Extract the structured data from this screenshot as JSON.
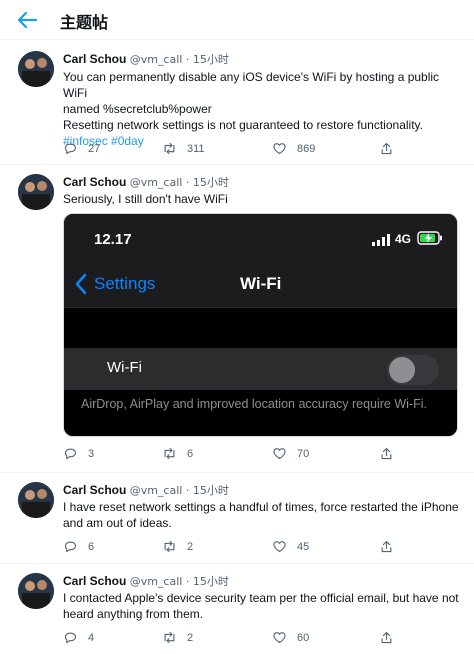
{
  "header": {
    "title": "主题帖",
    "back_icon": "arrow-left-icon",
    "accent": "#1d9bf0"
  },
  "tweets": [
    {
      "author": "Carl Schou",
      "meta": "@vm_call · 15小时",
      "text_lines": [
        "You can permanently disable any iOS device's WiFi by hosting a public WiFi",
        "named %secretclub%power",
        "Resetting network settings is not guaranteed to restore functionality."
      ],
      "hashtags": "#infosec #0day",
      "replies": "27",
      "retweets": "311",
      "likes": "869"
    },
    {
      "author": "Carl Schou",
      "meta": "@vm_call · 15小时",
      "text_lines": [
        "Seriously, I still don't have WiFi"
      ],
      "replies": "3",
      "retweets": "6",
      "likes": "70"
    },
    {
      "author": "Carl Schou",
      "meta": "@vm_call · 15小时",
      "text_lines": [
        "I have reset network settings a handful of times, force restarted the iPhone",
        "and am out of ideas."
      ],
      "replies": "6",
      "retweets": "2",
      "likes": "45"
    },
    {
      "author": "Carl Schou",
      "meta": "@vm_call · 15小时",
      "text_lines": [
        "I contacted Apple's device security team per the official email, but have not",
        "heard anything from them."
      ],
      "replies": "4",
      "retweets": "2",
      "likes": "60"
    }
  ],
  "media": {
    "time": "12.17",
    "network": "4G",
    "back_label": "Settings",
    "title": "Wi-Fi",
    "row_label": "Wi-Fi",
    "toggle_on": false,
    "footer": "AirDrop, AirPlay and improved location accuracy require Wi-Fi.",
    "accent": "#0a84ff"
  }
}
